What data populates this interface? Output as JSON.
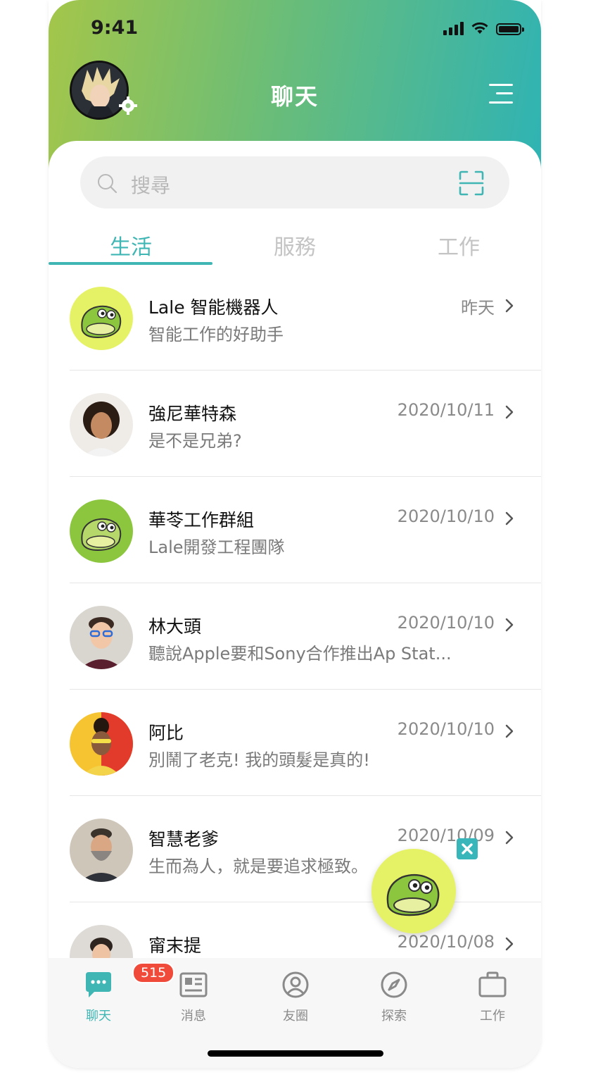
{
  "status_bar": {
    "time": "9:41"
  },
  "header": {
    "title": "聊天"
  },
  "search": {
    "placeholder": "搜尋"
  },
  "tabs": [
    {
      "label": "生活",
      "active": true
    },
    {
      "label": "服務",
      "active": false
    },
    {
      "label": "工作",
      "active": false
    }
  ],
  "chats": [
    {
      "name": "Lale 智能機器人",
      "message": "智能工作的好助手",
      "date": "昨天",
      "avatar": "bot-yellow"
    },
    {
      "name": "強尼華特森",
      "message": "是不是兄弟?",
      "date": "2020/10/11",
      "avatar": "person"
    },
    {
      "name": "華苓工作群組",
      "message": "Lale開發工程團隊",
      "date": "2020/10/10",
      "avatar": "bot-green"
    },
    {
      "name": "林大頭",
      "message": "聽說Apple要和Sony合作推出Ap Stat...",
      "date": "2020/10/10",
      "avatar": "person"
    },
    {
      "name": "阿比",
      "message": "別鬧了老克! 我的頭髮是真的!",
      "date": "2020/10/10",
      "avatar": "person"
    },
    {
      "name": "智慧老爹",
      "message": "生而為人，就是要追求極致。",
      "date": "2020/10/09",
      "avatar": "person"
    },
    {
      "name": "甯末提",
      "message": "",
      "date": "2020/10/08",
      "avatar": "person"
    }
  ],
  "tabbar": [
    {
      "label": "聊天",
      "icon": "chat-icon",
      "active": true,
      "badge": "515"
    },
    {
      "label": "消息",
      "icon": "news-icon",
      "active": false
    },
    {
      "label": "友圈",
      "icon": "friends-icon",
      "active": false
    },
    {
      "label": "探索",
      "icon": "compass-icon",
      "active": false
    },
    {
      "label": "工作",
      "icon": "briefcase-icon",
      "active": false
    }
  ],
  "colors": {
    "accent": "#3fb6b4",
    "badge": "#f04b3a",
    "fab": "#e6f265"
  }
}
